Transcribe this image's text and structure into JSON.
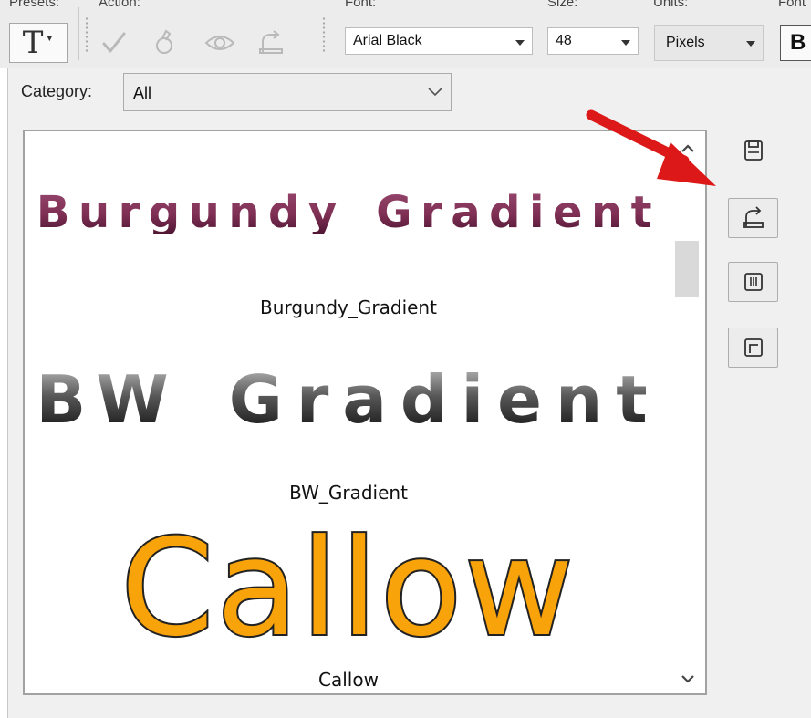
{
  "toolbar": {
    "presets_label": "Presets:",
    "action_label": "Action:",
    "font_label": "Font:",
    "size_label": "Size:",
    "units_label": "Units:",
    "format_label": "Font",
    "font_value": "Arial Black",
    "size_value": "48",
    "units_value": "Pixels",
    "bold_label": "B",
    "preset_glyph": "T"
  },
  "category": {
    "label": "Category:",
    "value": "All"
  },
  "styles": [
    {
      "preview": "Burgundy_Gradient",
      "name": "Burgundy_Gradient"
    },
    {
      "preview": "BW_Gradient",
      "name": "BW_Gradient"
    },
    {
      "preview": "Callow",
      "name": "Callow"
    }
  ],
  "side_buttons": [
    "save-icon",
    "load-icon",
    "rename-icon",
    "replace-icon"
  ],
  "colors": {
    "annotation_arrow": "#dc1818",
    "burgundy": "#7e2f53",
    "callow_fill": "#f9a30b"
  }
}
